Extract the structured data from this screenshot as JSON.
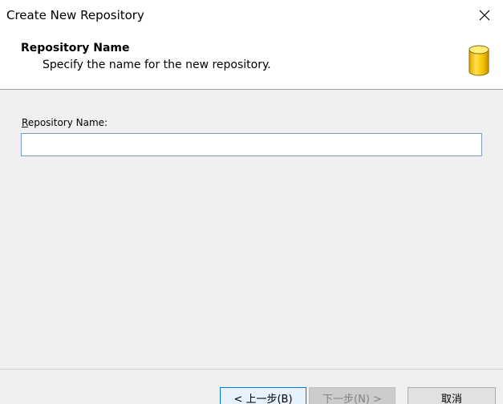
{
  "window": {
    "title": "Create New Repository"
  },
  "header": {
    "title": "Repository Name",
    "subtitle": "Specify the name for the new repository.",
    "icon": "database-icon",
    "icon_color": "#f5c400"
  },
  "form": {
    "label_mnemonic": "R",
    "label_rest": "epository Name:",
    "value": "",
    "placeholder": ""
  },
  "buttons": {
    "back": "< 上一步(B)",
    "next": "下一步(N) >",
    "cancel": "取消"
  },
  "colors": {
    "accent": "#0078d7",
    "input_border": "#7a9cc6",
    "disabled_text": "#838383"
  }
}
